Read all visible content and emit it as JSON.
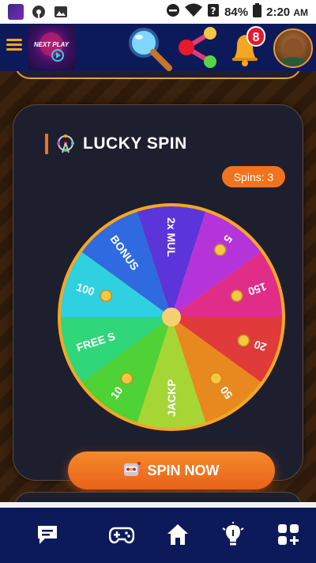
{
  "status_bar": {
    "battery": "84%",
    "time": "2:20",
    "am_pm": "AM",
    "icons": [
      "app-icon",
      "podcast-icon",
      "image-icon",
      "dnd-icon",
      "wifi-icon",
      "signal-unknown-icon",
      "battery-icon"
    ]
  },
  "header": {
    "logo_text_top": "NEXT PLAY",
    "notifications_count": "8",
    "icons": [
      "menu-icon",
      "search-icon",
      "share-network-icon",
      "bell-icon"
    ],
    "accent": "#f5a623",
    "background": "#0d1a5a"
  },
  "lucky_spin": {
    "title": "LUCKY SPIN",
    "spins_label": "Spins: 3",
    "button_label": "SPIN NOW",
    "title_icon": "ferris-wheel-icon",
    "button_icon": "slot-machine-icon",
    "accent": "#f2731e",
    "wheel_segments": [
      {
        "label": "2x MUL",
        "color": "#5b35d9",
        "coin": false
      },
      {
        "label": "5",
        "color": "#b534d9",
        "coin": true
      },
      {
        "label": "150",
        "color": "#df2d88",
        "coin": true
      },
      {
        "label": "20",
        "color": "#e03a3a",
        "coin": true
      },
      {
        "label": "50",
        "color": "#e8891f",
        "coin": true
      },
      {
        "label": "JACKP",
        "color": "#a6d636",
        "coin": false
      },
      {
        "label": "10",
        "color": "#4ed236",
        "coin": true
      },
      {
        "label": "FREE S",
        "color": "#2fd67a",
        "coin": false
      },
      {
        "label": "100",
        "color": "#2fd0e0",
        "coin": true
      },
      {
        "label": "BONUS",
        "color": "#2f6ae0",
        "coin": false
      }
    ],
    "wheel_rim_color": "#f5a623"
  },
  "bottom_nav": {
    "items": [
      {
        "name": "messages",
        "icon": "chat-icon"
      },
      {
        "name": "games",
        "icon": "gamepad-icon"
      },
      {
        "name": "home",
        "icon": "home-icon"
      },
      {
        "name": "tips",
        "icon": "lightbulb-icon"
      },
      {
        "name": "add-widget",
        "icon": "grid-add-icon"
      }
    ]
  }
}
